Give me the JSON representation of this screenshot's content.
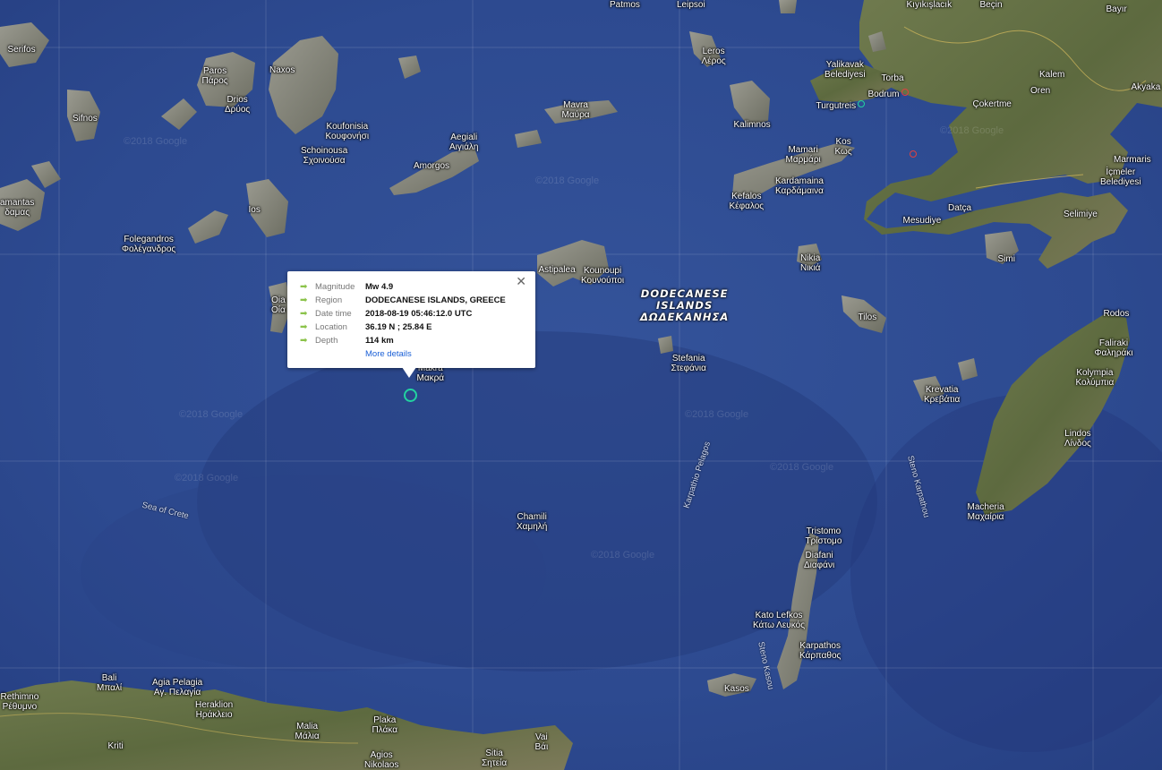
{
  "map": {
    "region_label": [
      "DODECANESE",
      "ISLANDS",
      "ΔΩΔΕΚΑΝΗΣΑ"
    ],
    "sea_labels": [
      "Sea of Crete",
      "Karpathio Pelagos",
      "Steno Karpathou",
      "Steno Kasou"
    ],
    "watermark": "©2018 Google",
    "places": [
      {
        "text": "Serifos"
      },
      {
        "text": "Sifnos"
      },
      {
        "text": "Paros\nΠάρος"
      },
      {
        "text": "Drios\nΔρύος"
      },
      {
        "text": "Naxos"
      },
      {
        "text": "Koufonisia\nΚουφονήσι"
      },
      {
        "text": "Schoinousa\nΣχοινούσα"
      },
      {
        "text": "Aegiali\nΑιγιάλη"
      },
      {
        "text": "Amorgos"
      },
      {
        "text": "Mavra\nΜαύρα"
      },
      {
        "text": "Leros\nΛέρος"
      },
      {
        "text": "Kalimnos"
      },
      {
        "text": "Mamari\nΜαρμάρι"
      },
      {
        "text": "Kos\nΚως"
      },
      {
        "text": "Kardamaina\nΚαρδάμαινα"
      },
      {
        "text": "Kefalos\nΚέφαλος"
      },
      {
        "text": "Yalikavak\nBelediyesi"
      },
      {
        "text": "Torba"
      },
      {
        "text": "Bodrum"
      },
      {
        "text": "Turgutreis"
      },
      {
        "text": "Kıyıkışlacık"
      },
      {
        "text": "Beçin"
      },
      {
        "text": "Bayır"
      },
      {
        "text": "Kalem"
      },
      {
        "text": "Oren"
      },
      {
        "text": "Çokertme"
      },
      {
        "text": "Akyaka"
      },
      {
        "text": "Marmaris"
      },
      {
        "text": "İçmeler\nBelediyesi"
      },
      {
        "text": "Datça"
      },
      {
        "text": "Mesudiye"
      },
      {
        "text": "Selimiye"
      },
      {
        "text": "Simi"
      },
      {
        "text": "Nikia\nΝικιά"
      },
      {
        "text": "Tilos"
      },
      {
        "text": "Rodos"
      },
      {
        "text": "Faliraki\nΦαληράκι"
      },
      {
        "text": "Kolympia\nΚολύμπια"
      },
      {
        "text": "Krevatia\nΚρεβάτια"
      },
      {
        "text": "Lindos\nΛίνδος"
      },
      {
        "text": "Macheria\nΜαχαίρια"
      },
      {
        "text": "Astipalea"
      },
      {
        "text": "Kounoupi\nΚουνούποι"
      },
      {
        "text": "Stefania\nΣτεφάνια"
      },
      {
        "text": "Makra\nΜακρά"
      },
      {
        "text": "Ios"
      },
      {
        "text": "Folegandros\nΦολέγανδρος"
      },
      {
        "text": "amantas\nδαμας"
      },
      {
        "text": "Oia\nΟία"
      },
      {
        "text": "Chamili\nΧαμηλή"
      },
      {
        "text": "Tristomo\nΤρίστομο"
      },
      {
        "text": "Diafani\nΔιαφάνι"
      },
      {
        "text": "Kato Lefkos\nΚάτω Λευκός"
      },
      {
        "text": "Karpathos\nΚάρπαθος"
      },
      {
        "text": "Kasos"
      },
      {
        "text": "Rethimno\nΡέθυμνο"
      },
      {
        "text": "Bali\nΜπαλί"
      },
      {
        "text": "Agia Pelagia\nΑγ. Πελαγία"
      },
      {
        "text": "Heraklion\nΗράκλειο"
      },
      {
        "text": "Kriti"
      },
      {
        "text": "Malia\nΜάλια"
      },
      {
        "text": "Plaka\nΠλάκα"
      },
      {
        "text": "Agios\nNikolaos"
      },
      {
        "text": "Sitia\nΣητεία"
      },
      {
        "text": "Vai\nΒάι"
      },
      {
        "text": "Patmos"
      },
      {
        "text": "Leipsoi"
      }
    ]
  },
  "popup": {
    "rows": [
      {
        "key": "Magnitude",
        "value": "Mw 4.9"
      },
      {
        "key": "Region",
        "value": "DODECANESE ISLANDS, GREECE"
      },
      {
        "key": "Date time",
        "value": "2018-08-19 05:46:12.0 UTC"
      },
      {
        "key": "Location",
        "value": "36.19 N ; 25.84 E"
      },
      {
        "key": "Depth",
        "value": "114 km"
      }
    ],
    "more_details": "More details",
    "close_glyph": "✕",
    "arrow_glyph": "➡",
    "arrow_color": "#8bc34a",
    "marker_color": "#22d3a0"
  }
}
